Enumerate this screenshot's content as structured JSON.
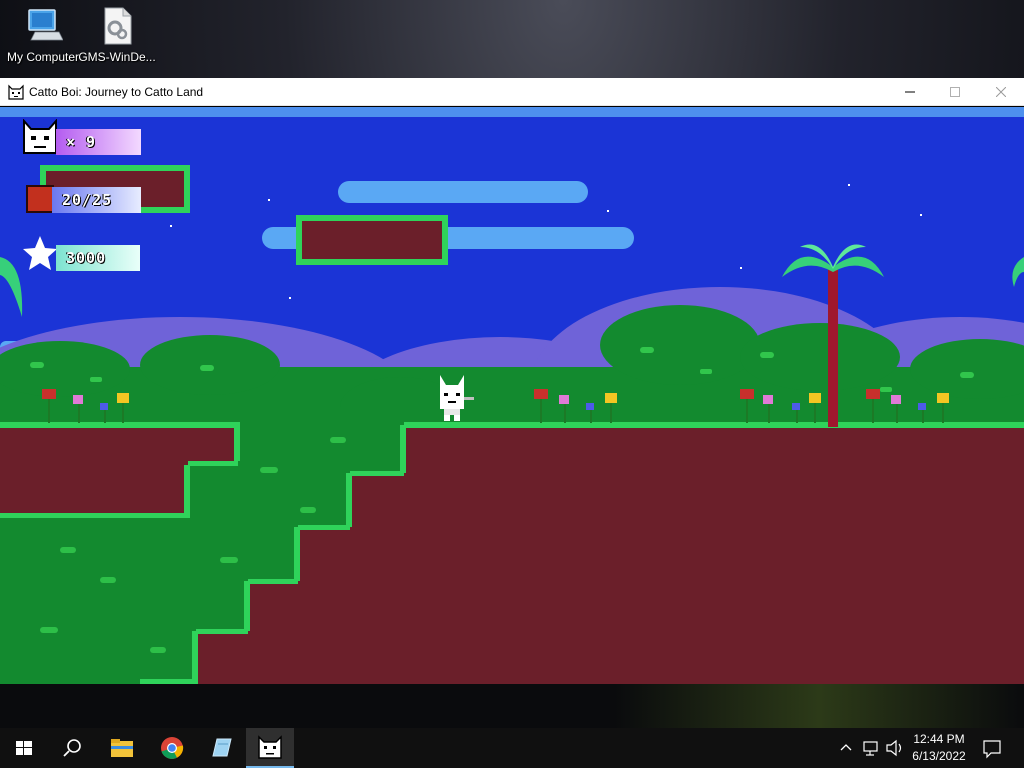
{
  "desktop": {
    "icons": [
      {
        "label": "My Computer",
        "icon": "computer-icon"
      },
      {
        "label": "GMS-WinDe...",
        "icon": "settings-file-icon"
      }
    ]
  },
  "window": {
    "title": "Catto Boi: Journey to Catto Land",
    "icon": "cat-face-icon",
    "controls": [
      "minimize-icon",
      "maximize-icon",
      "close-icon"
    ]
  },
  "hud": {
    "lives": "× 9",
    "blocks": "20/25",
    "score": "3000"
  },
  "taskbar": {
    "items": [
      "windows-start-icon",
      "search-icon",
      "file-explorer-icon",
      "chrome-icon",
      "notepad-icon",
      "cat-game-icon"
    ],
    "time": "12:44 PM",
    "date": "6/13/2022",
    "tray_icons": [
      "chevron-up-icon",
      "network-icon",
      "volume-icon",
      "notification-icon"
    ]
  },
  "colors": {
    "sky": "#1b34d6",
    "ground": "#6b1f2a",
    "grass": "#2fd35a",
    "foliage": "#0f8a2e"
  }
}
